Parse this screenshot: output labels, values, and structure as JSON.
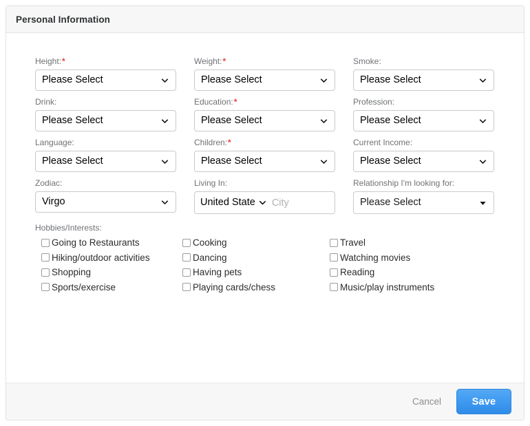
{
  "card": {
    "header_title": "Personal Information"
  },
  "form": {
    "rows": [
      [
        {
          "label": "Height:",
          "required": true,
          "value": "Please Select"
        },
        {
          "label": "Weight:",
          "required": true,
          "value": "Please Select"
        },
        {
          "label": "Smoke:",
          "required": false,
          "value": "Please Select"
        }
      ],
      [
        {
          "label": "Drink:",
          "required": false,
          "value": "Please Select"
        },
        {
          "label": "Education:",
          "required": true,
          "value": "Please Select"
        },
        {
          "label": "Profession:",
          "required": false,
          "value": "Please Select"
        }
      ],
      [
        {
          "label": "Language:",
          "required": false,
          "value": "Please Select"
        },
        {
          "label": "Children:",
          "required": true,
          "value": "Please Select"
        },
        {
          "label": "Current Income:",
          "required": false,
          "value": "Please Select"
        }
      ]
    ],
    "zodiac": {
      "label": "Zodiac:",
      "required": false,
      "value": "Virgo"
    },
    "living_in": {
      "label": "Living In:",
      "country_value": "United State",
      "city_value": "",
      "city_placeholder": "City"
    },
    "relationship": {
      "label": "Relationship I'm looking for:",
      "required": false,
      "value": "Please Select"
    },
    "required_marker": "*"
  },
  "hobbies": {
    "label": "Hobbies/Interests:",
    "rows": [
      [
        "Going to Restaurants",
        "Cooking",
        "Travel"
      ],
      [
        "Hiking/outdoor activities",
        "Dancing",
        "Watching movies"
      ],
      [
        "Shopping",
        "Having pets",
        "Reading"
      ],
      [
        "Sports/exercise",
        "Playing cards/chess",
        "Music/play instruments"
      ]
    ]
  },
  "footer": {
    "cancel_label": "Cancel",
    "save_label": "Save"
  },
  "colors": {
    "required_red": "#e8413c",
    "save_blue": "#3f9af0",
    "header_bg": "#f7f7f7",
    "label_gray": "#6f7175"
  }
}
